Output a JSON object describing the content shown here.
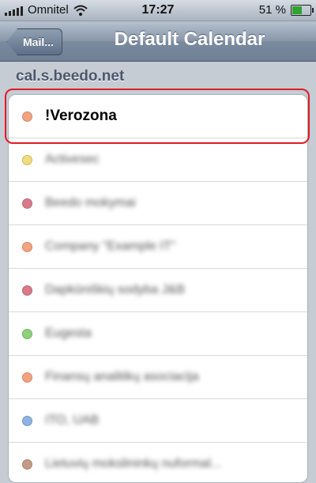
{
  "status_bar": {
    "carrier": "Omnitel",
    "time": "17:27",
    "battery_percent": "51 %",
    "battery_level": 0.51
  },
  "nav": {
    "back_label": "Mail...",
    "title": "Default Calendar"
  },
  "account": "cal.s.beedo.net",
  "calendars": [
    {
      "label": "!Verozona",
      "color": "#f4a27f"
    },
    {
      "label": "Activesec",
      "color": "#f0dc7a"
    },
    {
      "label": "Beedo mokymai",
      "color": "#d9798a"
    },
    {
      "label": "Company \"Example IT\"",
      "color": "#f4a27f"
    },
    {
      "label": "Dapkūniškių sodyba J&B",
      "color": "#d9798a"
    },
    {
      "label": "Eugesta",
      "color": "#8fd07a"
    },
    {
      "label": "Finansų analitikų asociacija",
      "color": "#f4a27f"
    },
    {
      "label": "ITO, UAB",
      "color": "#8fb3e0"
    },
    {
      "label": "Lietuvių mokslininkų nuformal...",
      "color": "#c39a84"
    }
  ]
}
